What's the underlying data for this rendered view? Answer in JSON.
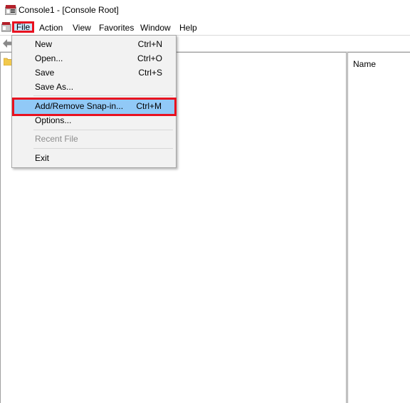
{
  "window": {
    "title": "Console1 - [Console Root]"
  },
  "menubar": {
    "items": [
      {
        "label": "File"
      },
      {
        "label": "Action"
      },
      {
        "label": "View"
      },
      {
        "label": "Favorites"
      },
      {
        "label": "Window"
      },
      {
        "label": "Help"
      }
    ]
  },
  "right_pane": {
    "column_header": "Name"
  },
  "file_menu": {
    "items": [
      {
        "label": "New",
        "shortcut": "Ctrl+N",
        "enabled": true
      },
      {
        "label": "Open...",
        "shortcut": "Ctrl+O",
        "enabled": true
      },
      {
        "label": "Save",
        "shortcut": "Ctrl+S",
        "enabled": true
      },
      {
        "label": "Save As...",
        "shortcut": "",
        "enabled": true
      },
      {
        "label": "Add/Remove Snap-in...",
        "shortcut": "Ctrl+M",
        "enabled": true,
        "highlighted": true
      },
      {
        "label": "Options...",
        "shortcut": "",
        "enabled": true
      },
      {
        "label": "Recent File",
        "shortcut": "",
        "enabled": false
      },
      {
        "label": "Exit",
        "shortcut": "",
        "enabled": true
      }
    ]
  },
  "colors": {
    "annotation_red": "#e8111f",
    "menu_highlight": "#91c9f7",
    "menu_background": "#f2f2f2",
    "disabled_text": "#8c8c8c"
  },
  "icons": [
    "mmc-app-icon",
    "mmc-menubar-icon",
    "back-arrow-icon",
    "folder-icon"
  ]
}
